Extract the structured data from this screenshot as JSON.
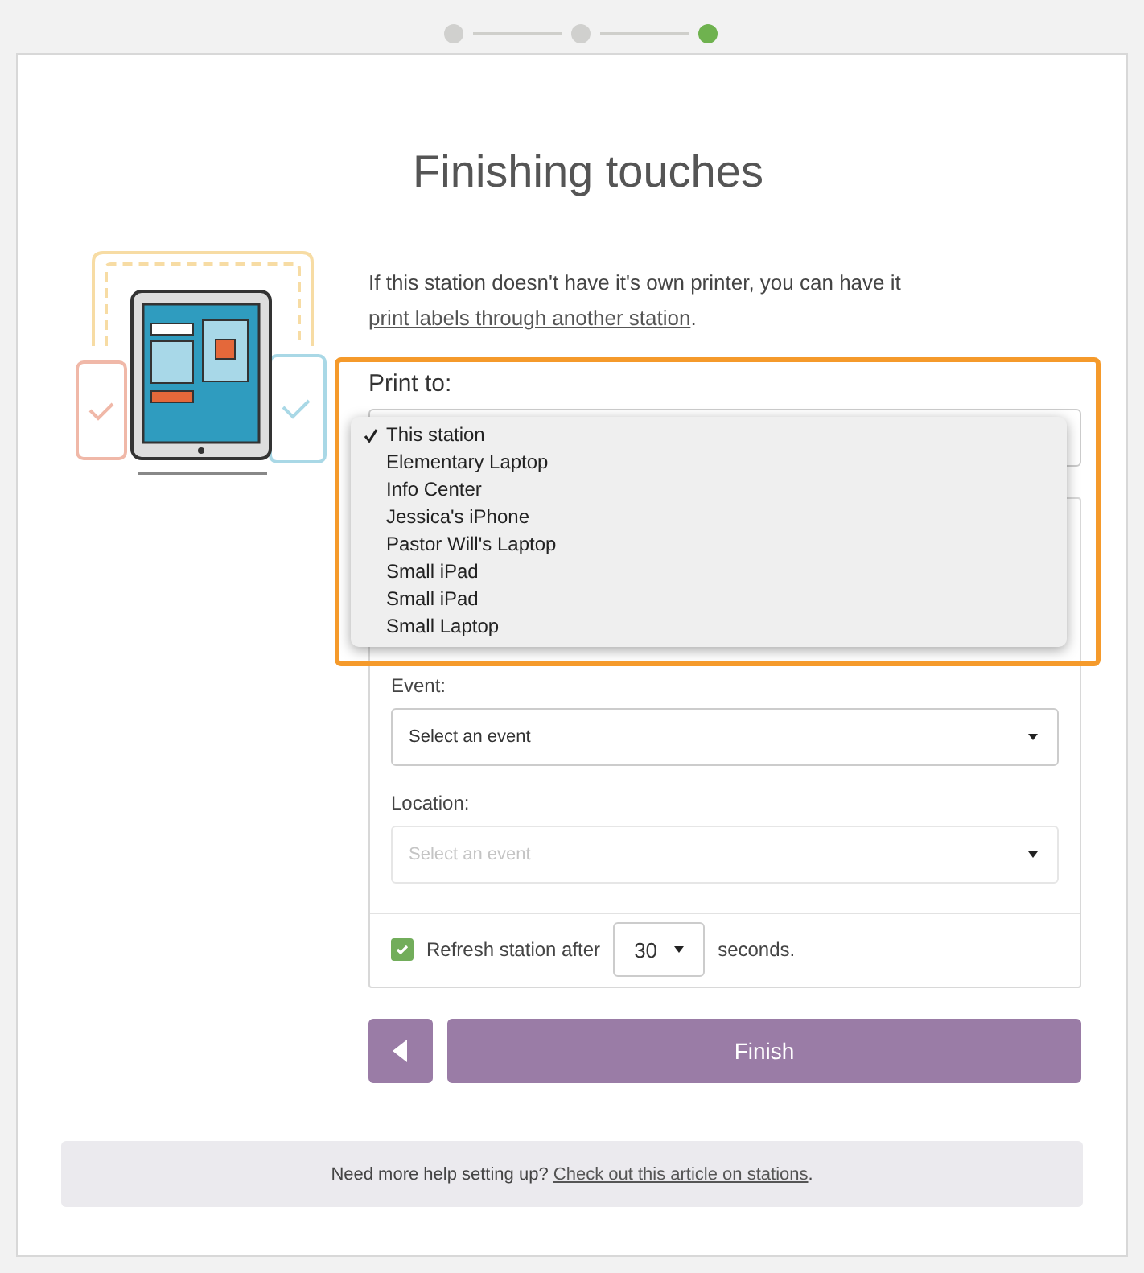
{
  "stepper": [
    {
      "selected": false
    },
    {
      "selected": false
    },
    {
      "selected": true
    }
  ],
  "title": "Finishing touches",
  "intro": {
    "text": "If this station doesn't have it's own printer, you can have it ",
    "link": "print labels through another station",
    "end": "."
  },
  "print_to": {
    "label": "Print to:",
    "options": [
      {
        "label": "This station",
        "selected": true
      },
      {
        "label": "Elementary Laptop",
        "selected": false
      },
      {
        "label": "Info Center",
        "selected": false
      },
      {
        "label": "Jessica's iPhone",
        "selected": false
      },
      {
        "label": "Pastor Will's Laptop",
        "selected": false
      },
      {
        "label": "Small iPad",
        "selected": false
      },
      {
        "label": "Small iPad",
        "selected": false
      },
      {
        "label": "Small Laptop",
        "selected": false
      }
    ]
  },
  "event": {
    "label": "Event:",
    "placeholder": "Select an event",
    "disabled": false
  },
  "location": {
    "label": "Location:",
    "placeholder": "Select an event",
    "disabled": true
  },
  "refresh": {
    "label": "Refresh station after",
    "checked": true,
    "value": "30",
    "unit": "seconds."
  },
  "finish_button": "Finish",
  "help": {
    "text": "Need more help setting up? ",
    "link": "Check out this article on stations",
    "end": "."
  }
}
